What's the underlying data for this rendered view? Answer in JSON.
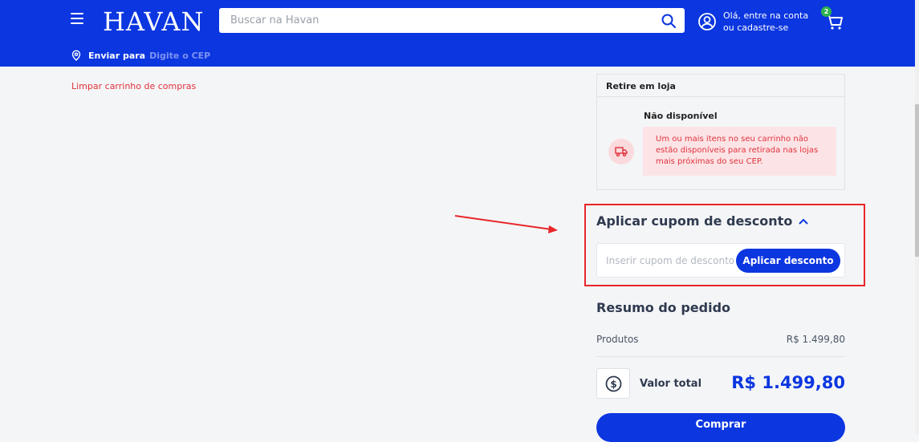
{
  "header": {
    "logo": "HAVAN",
    "search_placeholder": "Buscar na Havan",
    "account_line1": "Olá, entre na conta",
    "account_line2": "ou cadastre-se",
    "cart_count": "2",
    "ship_label": "Enviar para",
    "ship_placeholder": "Digite o CEP"
  },
  "cart": {
    "clear_link": "Limpar carrinho de compras"
  },
  "pickup": {
    "title": "Retire em loja",
    "status": "Não disponível",
    "message": "Um ou mais itens no seu carrinho não estão disponíveis para retirada nas lojas mais próximas do seu CEP."
  },
  "coupon": {
    "title": "Aplicar cupom de desconto",
    "placeholder": "Inserir cupom de desconto",
    "button": "Aplicar desconto"
  },
  "summary": {
    "title": "Resumo do pedido",
    "products_label": "Produtos",
    "products_value": "R$ 1.499,80",
    "total_label": "Valor total",
    "total_value": "R$ 1.499,80",
    "buy_button": "Comprar"
  },
  "colors": {
    "brand_blue": "#0b36e0",
    "alert_red": "#e0323c",
    "badge_green": "#2db14b",
    "highlight_red": "#e8262a"
  }
}
